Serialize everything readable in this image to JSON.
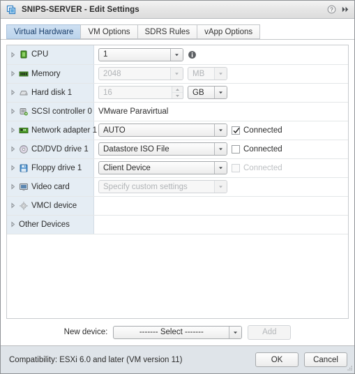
{
  "window": {
    "title": "SNIPS-SERVER - Edit Settings",
    "icon": "vm-icon",
    "help_icon": "help-icon",
    "expand_icon": "expand-chevrons-icon"
  },
  "tabs": [
    {
      "label": "Virtual Hardware",
      "active": true
    },
    {
      "label": "VM Options",
      "active": false
    },
    {
      "label": "SDRS Rules",
      "active": false
    },
    {
      "label": "vApp Options",
      "active": false
    }
  ],
  "devices": [
    {
      "name": "CPU",
      "icon": "cpu-icon",
      "control": "combo",
      "value": "1",
      "width_class": "w-cpu",
      "disabled": false,
      "info_icon": "info-icon"
    },
    {
      "name": "Memory",
      "icon": "memory-icon",
      "control": "combo",
      "value": "2048",
      "width_class": "w-mem",
      "disabled": true,
      "unit": "MB",
      "unit_disabled": true
    },
    {
      "name": "Hard disk 1",
      "icon": "harddisk-icon",
      "control": "spinner",
      "value": "16",
      "disabled": true,
      "unit": "GB",
      "unit_disabled": false
    },
    {
      "name": "SCSI controller 0",
      "icon": "scsi-controller-icon",
      "control": "text",
      "value": "VMware Paravirtual"
    },
    {
      "name": "Network adapter 1",
      "icon": "network-adapter-icon",
      "control": "combo",
      "value": "AUTO",
      "width_class": "w-net",
      "disabled": false,
      "checkbox": {
        "label": "Connected",
        "checked": true,
        "disabled": false
      }
    },
    {
      "name": "CD/DVD drive 1",
      "icon": "cddvd-icon",
      "control": "combo",
      "value": "Datastore ISO File",
      "width_class": "w-cd",
      "disabled": false,
      "checkbox": {
        "label": "Connected",
        "checked": false,
        "disabled": false
      }
    },
    {
      "name": "Floppy drive 1",
      "icon": "floppy-icon",
      "control": "combo",
      "value": "Client Device",
      "width_class": "w-floppy",
      "disabled": false,
      "checkbox": {
        "label": "Connected",
        "checked": false,
        "disabled": true
      }
    },
    {
      "name": "Video card",
      "icon": "videocard-icon",
      "control": "combo",
      "value": "Specify custom settings",
      "width_class": "w-video",
      "disabled": true
    },
    {
      "name": "VMCI device",
      "icon": "vmci-icon",
      "control": "none",
      "value": ""
    },
    {
      "name": "Other Devices",
      "icon": "",
      "control": "none",
      "value": ""
    }
  ],
  "new_device": {
    "label": "New device:",
    "selected": "------- Select -------",
    "add_label": "Add",
    "add_disabled": true
  },
  "footer": {
    "compatibility": "Compatibility: ESXi 6.0 and later (VM version 11)",
    "ok_label": "OK",
    "cancel_label": "Cancel"
  },
  "colors": {
    "accent": "#cfe0f2",
    "accent_text": "#1a3f6b",
    "name_column_bg": "#e5edf4",
    "footer_bg": "#dfe4e9",
    "icon_green": "#4b9a28",
    "icon_blue": "#3d7ebf"
  }
}
